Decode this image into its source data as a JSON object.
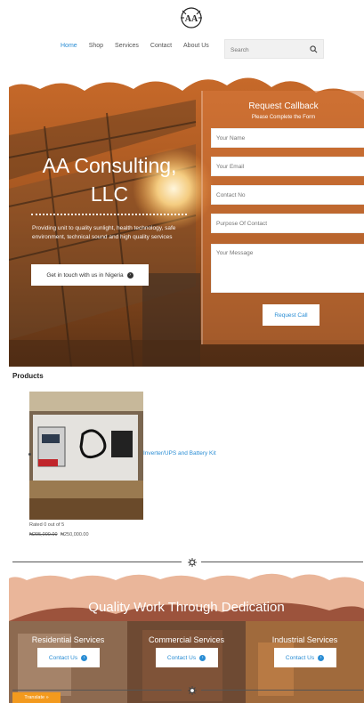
{
  "logo": {
    "text": "AA"
  },
  "nav": {
    "items": [
      {
        "label": "Home",
        "active": true
      },
      {
        "label": "Shop",
        "active": false
      },
      {
        "label": "Services",
        "active": false
      },
      {
        "label": "Contact",
        "active": false
      },
      {
        "label": "About Us",
        "active": false
      }
    ]
  },
  "search": {
    "placeholder": "Search",
    "icon": "search-icon"
  },
  "hero": {
    "title": "AA Consulting, LLC",
    "text": "Providing unit to quality sunlight, health technology, safe environment, technical sound and high quality services",
    "button_label": "Get in touch with us in Nigeria"
  },
  "callback": {
    "title": "Request Callback",
    "subtitle": "Please Complete the Form",
    "fields": {
      "name": "Your Name",
      "email": "Your Email",
      "phone": "Contact No",
      "purpose": "Purpose Of Contact",
      "message": "Your Message"
    },
    "submit_label": "Request Call"
  },
  "products": {
    "title": "Products",
    "item": {
      "name": "Inverter/UPS and Battery Kit",
      "rating": "Rated 0 out of 5",
      "old_price": "₦295,000.00",
      "price": "₦250,000.00"
    }
  },
  "quality": {
    "title": "Quality Work Through Dedication",
    "services": [
      {
        "label": "Residential Services",
        "button": "Contact Us"
      },
      {
        "label": "Commercial Services",
        "button": "Contact Us"
      },
      {
        "label": "Industrial Services",
        "button": "Contact Us"
      }
    ]
  },
  "translate": {
    "label": "Translate »"
  },
  "colors": {
    "accent": "#2a8dd4",
    "hero_orange": "#d9783c",
    "translate": "#f39a1e"
  }
}
